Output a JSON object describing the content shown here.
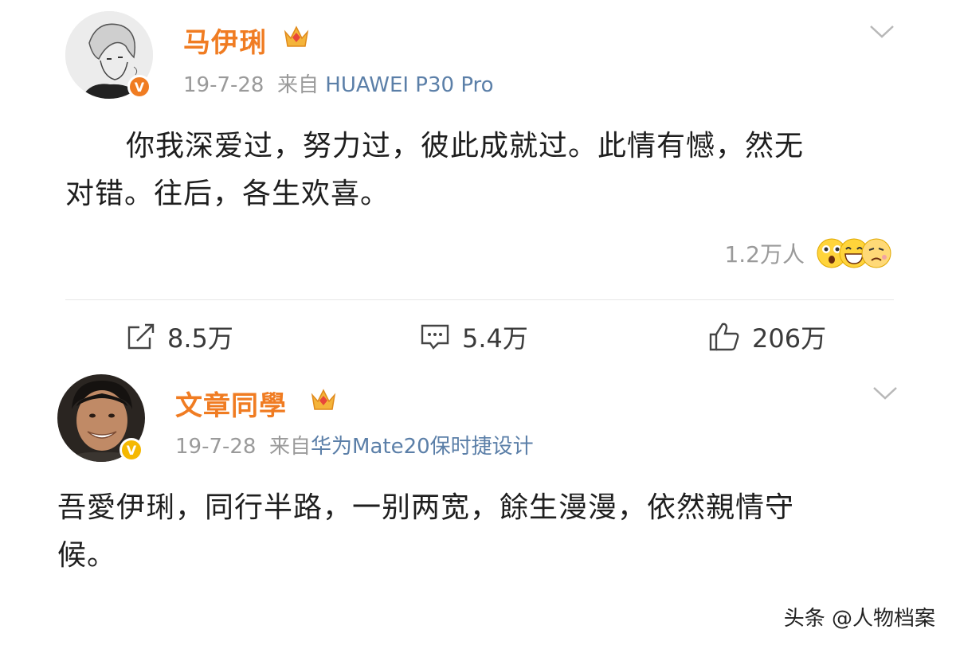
{
  "post1": {
    "username": "马伊琍",
    "date": "19-7-28",
    "source_prefix": "来自",
    "device": "HUAWEI P30 Pro",
    "body_line1": "你我深爱过，努力过，彼此成就过。此情有憾，然无",
    "body_line2": "对错。往后，各生欢喜。",
    "reactions_count": "1.2万人",
    "actions": {
      "repost": "8.5万",
      "comment": "5.4万",
      "like": "206万"
    },
    "verify_badge": "V",
    "colors": {
      "verify": "#f07c22",
      "username": "#f07c22"
    }
  },
  "post2": {
    "username": "文章同學",
    "date": "19-7-28",
    "source_prefix": "来自",
    "device": "华为Mate20保时捷设计",
    "body_line1": "吾愛伊琍，同行半路，一别两宽，餘生漫漫，依然親情守",
    "body_line2": "候。",
    "verify_badge": "V",
    "colors": {
      "verify": "#f5b800",
      "username": "#f07c22"
    }
  },
  "watermark": "头条 @人物档案",
  "icons": [
    "chevron-down-icon",
    "crown-icon",
    "repost-icon",
    "comment-icon",
    "like-icon",
    "emoji-surprised-icon",
    "emoji-laugh-icon",
    "emoji-sad-icon"
  ]
}
